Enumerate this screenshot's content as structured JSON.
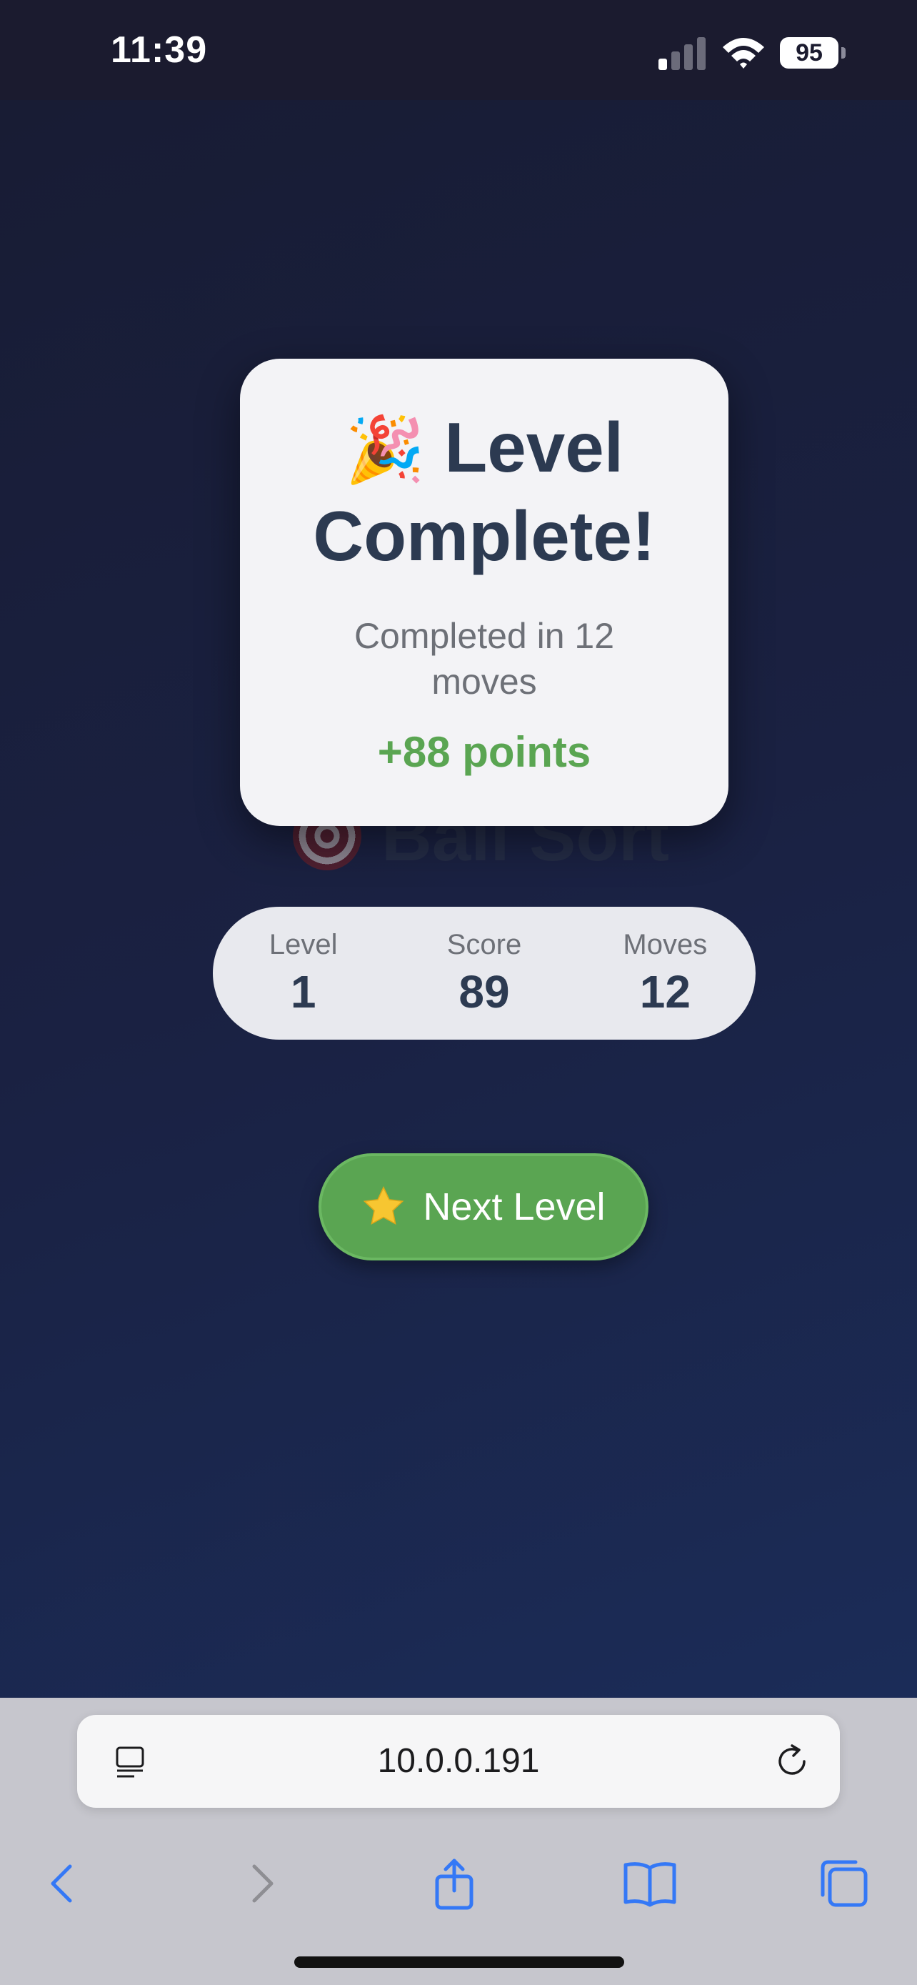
{
  "status_bar": {
    "time": "11:39",
    "battery": "95"
  },
  "background": {
    "title": "Ball Sort"
  },
  "modal": {
    "title": "Level Complete!",
    "emoji": "🎉",
    "subtitle": "Completed in 12 moves",
    "points": "+88 points"
  },
  "stats": [
    {
      "label": "Level",
      "value": "1"
    },
    {
      "label": "Score",
      "value": "89"
    },
    {
      "label": "Moves",
      "value": "12"
    }
  ],
  "next_button": {
    "label": "Next Level",
    "icon": "star-icon"
  },
  "browser": {
    "url": "10.0.0.191",
    "toolbar_icons": [
      "back-icon",
      "forward-icon",
      "share-icon",
      "bookmarks-icon",
      "tabs-icon"
    ]
  },
  "colors": {
    "accent_green": "#5aa552",
    "title_text": "#2c3a51",
    "link_blue": "#3478f6"
  }
}
